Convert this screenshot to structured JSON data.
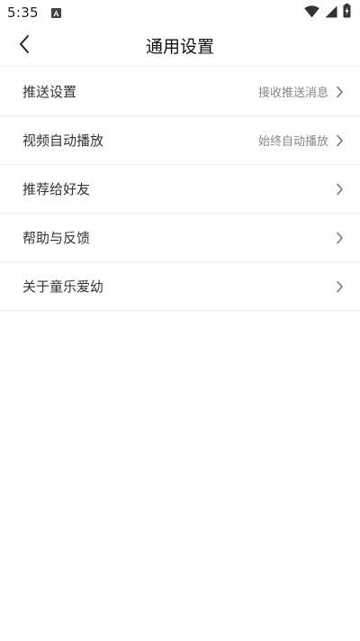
{
  "status_bar": {
    "time": "5:35",
    "icons": [
      "app-notification-icon",
      "wifi-icon",
      "signal-icon",
      "battery-charging-icon"
    ]
  },
  "header": {
    "title": "通用设置",
    "back_icon": "chevron-left-icon"
  },
  "settings": {
    "items": [
      {
        "label": "推送设置",
        "value": "接收推送消息"
      },
      {
        "label": "视频自动播放",
        "value": "始终自动播放"
      },
      {
        "label": "推荐给好友",
        "value": ""
      },
      {
        "label": "帮助与反馈",
        "value": ""
      },
      {
        "label": "关于童乐爱幼",
        "value": ""
      }
    ]
  },
  "colors": {
    "label": "#333333",
    "value": "#888888",
    "divider": "#eeeeee",
    "background": "#ffffff"
  }
}
